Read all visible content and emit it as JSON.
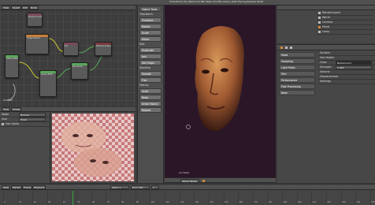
{
  "top_bar": {
    "info_text": "Time:00:01.34 | Mem:174.5M, Peak:174.5M | Done | Path Tracing Sample 10/10"
  },
  "node_editor": {
    "menu": [
      "View",
      "Select",
      "Add",
      "Node"
    ],
    "node_labels": [
      "Image Texture",
      "Mix",
      "Diffuse BSDF",
      "Glossy BSDF",
      "Mix Shader",
      "Material Output",
      "Texture Coordinate"
    ],
    "status": "Untitled"
  },
  "uv_editor": {
    "menu": [
      "View",
      "Image"
    ],
    "props": [
      {
        "label": "Mode",
        "value": "Normal"
      },
      {
        "label": "Size",
        "value": "Prism"
      },
      {
        "label": "",
        "value": "Use Alpha"
      }
    ]
  },
  "toolshelf": {
    "header": "Object Tools",
    "sections": [
      {
        "title": "Transform",
        "items": [
          "Translate",
          "Rotate",
          "Scale",
          "Mirror"
        ]
      },
      {
        "title": "Edit",
        "items": [
          "Duplicate",
          "Join",
          "Set Origin"
        ]
      },
      {
        "title": "Shading",
        "items": [
          "Smooth",
          "Flat"
        ]
      },
      {
        "title": "History",
        "items": [
          "Undo",
          "Redo",
          "Undo History",
          "Repeat"
        ]
      }
    ]
  },
  "viewport": {
    "header_text": "Time:00:01.34 | Mem:174.5M | Path Tracing Sample 10/10",
    "mode_label": "Object Mode",
    "corner_label": "(1) Head",
    "bg_color": "#2b1628",
    "face_color": "#a05a32"
  },
  "outliner": {
    "items": [
      "RenderLayers",
      "World",
      "Camera",
      "Head",
      "Lamp"
    ]
  },
  "properties": {
    "object_name": "Head",
    "sections": [
      "Surface",
      "Use Nodes",
      "Volume",
      "Displacement",
      "Settings"
    ],
    "color_label": "Color",
    "color_value": "Background",
    "strength_label": "Strength",
    "strength_value": "1.000",
    "buttons": [
      "Sampling",
      "Light Paths",
      "Film",
      "Performance",
      "Post Processing",
      "Bake"
    ]
  },
  "timeline": {
    "menu": [
      "View",
      "Marker",
      "Frame",
      "Playback"
    ],
    "start_label": "Start: 1",
    "end_label": "End: 250",
    "current": "1",
    "ticks": [
      "0",
      "10",
      "20",
      "30",
      "40",
      "50",
      "60",
      "70",
      "80",
      "90",
      "100",
      "110",
      "120",
      "130",
      "140",
      "150",
      "160",
      "170",
      "180",
      "190",
      "200",
      "210",
      "220",
      "230",
      "240",
      "250"
    ]
  }
}
